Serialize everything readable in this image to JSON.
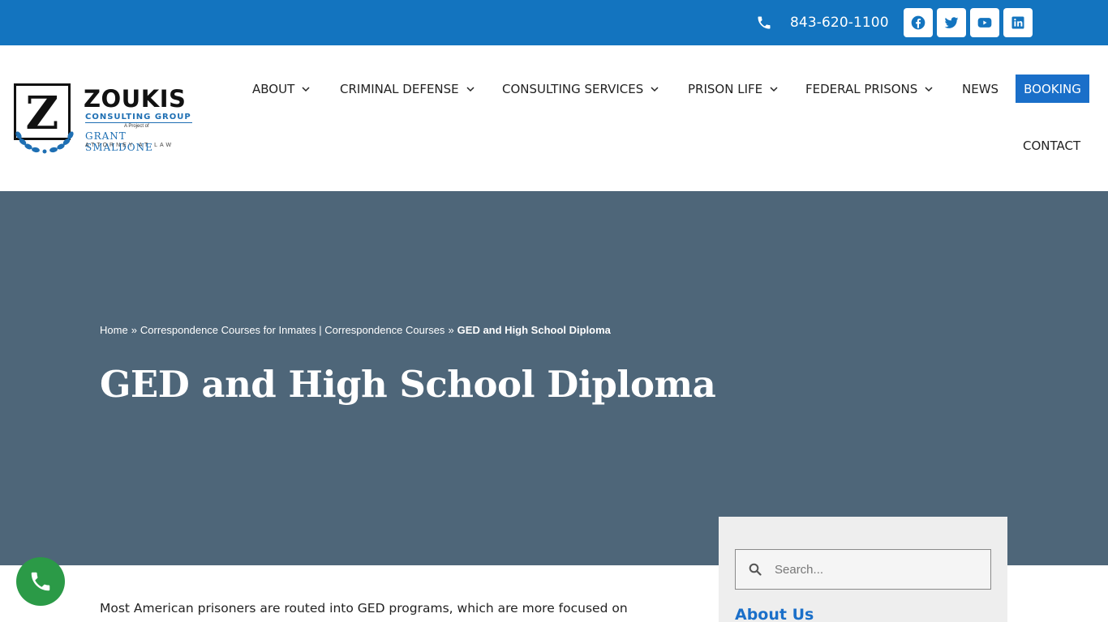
{
  "topbar": {
    "phone": "843-620-1100",
    "social": [
      {
        "icon": "facebook-icon"
      },
      {
        "icon": "twitter-icon"
      },
      {
        "icon": "youtube-icon"
      },
      {
        "icon": "linkedin-icon"
      }
    ]
  },
  "logo": {
    "letter": "Z",
    "name": "ZOUKIS",
    "subtitle": "CONSULTING GROUP",
    "project_line": "A Project of",
    "firm": "GRANT SMALDONE",
    "firm_sub": "ATTORNEY AT LAW"
  },
  "nav": {
    "about": "ABOUT",
    "criminal_defense": "CRIMINAL DEFENSE",
    "consulting_services": "CONSULTING SERVICES",
    "prison_life": "PRISON LIFE",
    "federal_prisons": "FEDERAL PRISONS",
    "news": "NEWS",
    "booking": "BOOKING",
    "contact": "CONTACT"
  },
  "breadcrumb": {
    "home": "Home",
    "separator": "»",
    "parent": "Correspondence Courses for Inmates | Correspondence Courses",
    "current": "GED and High School Diploma"
  },
  "page": {
    "title": "GED and High School Diploma",
    "intro": "Most American prisoners are routed into GED programs, which are more focused on"
  },
  "sidebar": {
    "search_placeholder": "Search...",
    "about_heading": "About Us"
  },
  "colors": {
    "topbar": "#1374bf",
    "hero": "#4e6679",
    "accent": "#1a6fc9",
    "call_button": "#2b9a47"
  }
}
